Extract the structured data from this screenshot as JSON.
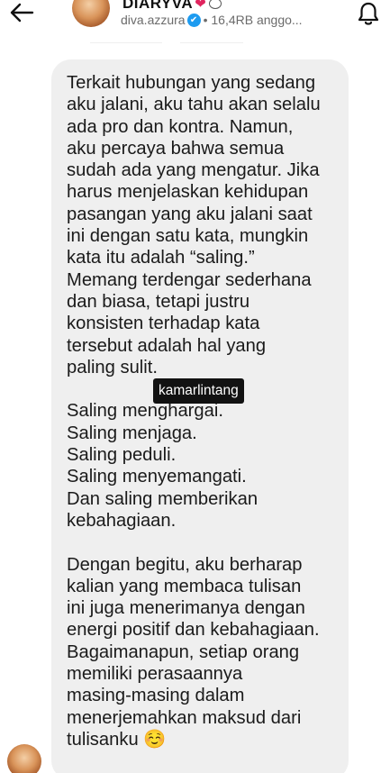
{
  "header": {
    "back_icon": "arrow-left-icon",
    "channel_name": "DIARYVA",
    "heart_icon": "❤",
    "bubble_icon": "speech-bubble-icon",
    "username": "diva.azzura",
    "verified_icon": "✔",
    "members": "• 16,4RB anggo...",
    "bell_icon": "bell-icon"
  },
  "message": {
    "paragraph1": [
      "Terkait hubungan yang sedang",
      "aku jalani, aku tahu akan selalu",
      "ada pro dan kontra. Namun,",
      "aku percaya bahwa semua",
      "sudah ada yang mengatur. Jika",
      "harus menjelaskan kehidupan",
      "pasangan yang aku jalani saat",
      "ini dengan satu kata, mungkin",
      "kata itu adalah “saling.”",
      "Memang terdengar sederhana",
      "dan biasa, tetapi justru",
      "konsisten terhadap kata",
      "tersebut adalah hal yang",
      "paling sulit."
    ],
    "paragraph2": [
      "Saling menghargai.",
      "Saling menjaga.",
      "Saling peduli.",
      "Saling menyemangati.",
      "Dan saling memberikan",
      "kebahagiaan."
    ],
    "paragraph3": [
      "Dengan begitu, aku berharap",
      "kalian yang membaca tulisan",
      "ini juga menerimanya dengan",
      "energi positif dan kebahagiaan.",
      "Bagaimanapun, setiap orang",
      "memiliki perasaannya",
      "masing-masing dalam",
      "menerjemahkan maksud dari",
      "tulisanku ☺️"
    ]
  },
  "watermark": "kamarlintang",
  "colors": {
    "bubble_bg": "#efefef",
    "verified": "#1d9bf0",
    "heart": "#e0245e",
    "watermark_bg": "#121212"
  }
}
